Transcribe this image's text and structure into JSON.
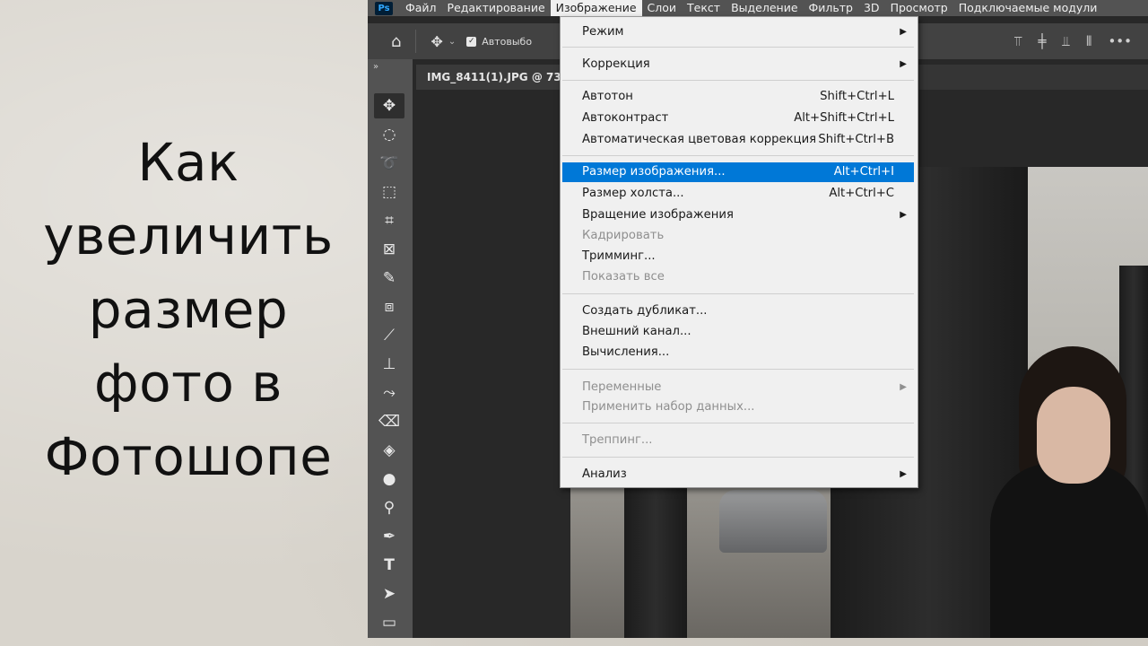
{
  "headline": [
    "Как",
    "увеличить",
    "размер",
    "фото в",
    "Фотошопе"
  ],
  "app": {
    "logo": "Ps",
    "menubar": [
      "Файл",
      "Редактирование",
      "Изображение",
      "Слои",
      "Текст",
      "Выделение",
      "Фильтр",
      "3D",
      "Просмотр",
      "Подключаемые модули"
    ],
    "active_menu": "Изображение",
    "options_bar": {
      "auto_select_label": "Автовыбо"
    },
    "document_tab": "IMG_8411(1).JPG @ 73,",
    "toolbar_collapse": "»"
  },
  "image_menu": {
    "mode": "Режим",
    "adjustments": "Коррекция",
    "auto_tone": {
      "label": "Автотон",
      "shortcut": "Shift+Ctrl+L"
    },
    "auto_contrast": {
      "label": "Автоконтраст",
      "shortcut": "Alt+Shift+Ctrl+L"
    },
    "auto_color": {
      "label": "Автоматическая цветовая коррекция",
      "shortcut": "Shift+Ctrl+B"
    },
    "image_size": {
      "label": "Размер изображения...",
      "shortcut": "Alt+Ctrl+I"
    },
    "canvas_size": {
      "label": "Размер холста...",
      "shortcut": "Alt+Ctrl+C"
    },
    "rotation": "Вращение изображения",
    "crop": "Кадрировать",
    "trim": "Тримминг...",
    "reveal_all": "Показать все",
    "duplicate": "Создать дубликат...",
    "apply_image": "Внешний канал...",
    "calculations": "Вычисления...",
    "variables": "Переменные",
    "apply_dataset": "Применить набор данных...",
    "trap": "Треппинг...",
    "analysis": "Анализ"
  },
  "colors": {
    "highlight": "#0078d7",
    "ps_dark": "#535353"
  }
}
